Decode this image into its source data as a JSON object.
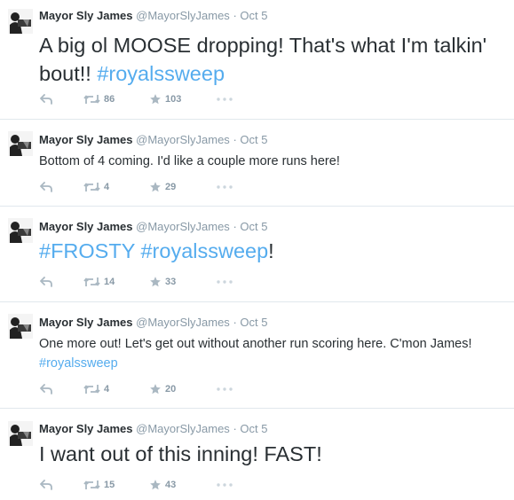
{
  "account": {
    "fullname": "Mayor Sly James",
    "screen_name": "@MayorSlyJames",
    "separator": "·"
  },
  "tweets": [
    {
      "timestamp": "Oct 5",
      "text_parts": [
        "A big ol MOOSE dropping!  That's what I'm talkin' bout!! ",
        "#royalssweep"
      ],
      "retweets": "86",
      "favorites": "103"
    },
    {
      "timestamp": "Oct 5",
      "text_parts": [
        "Bottom of 4 coming.  I'd like a couple more runs here!"
      ],
      "retweets": "4",
      "favorites": "29"
    },
    {
      "timestamp": "Oct 5",
      "text_parts": [
        "#FROSTY",
        " ",
        "#royalssweep",
        "!"
      ],
      "retweets": "14",
      "favorites": "33"
    },
    {
      "timestamp": "Oct 5",
      "text_parts": [
        "One more out!  Let's get out without  another run scoring here.  C'mon James! ",
        "#royalssweep"
      ],
      "retweets": "4",
      "favorites": "20"
    },
    {
      "timestamp": "Oct 5",
      "text_parts": [
        "I want out of this inning!  FAST!"
      ],
      "retweets": "15",
      "favorites": "43"
    }
  ],
  "icons": {
    "avatar": "avatar-photo",
    "reply": "reply-icon",
    "retweet": "retweet-icon",
    "favorite": "star-icon",
    "more": "more-dots-icon"
  },
  "colors": {
    "hashtag": "#55acee",
    "name": "#292f33",
    "meta": "#8899a6",
    "action_icon": "#aab8c2",
    "divider": "#e1e8ed"
  }
}
